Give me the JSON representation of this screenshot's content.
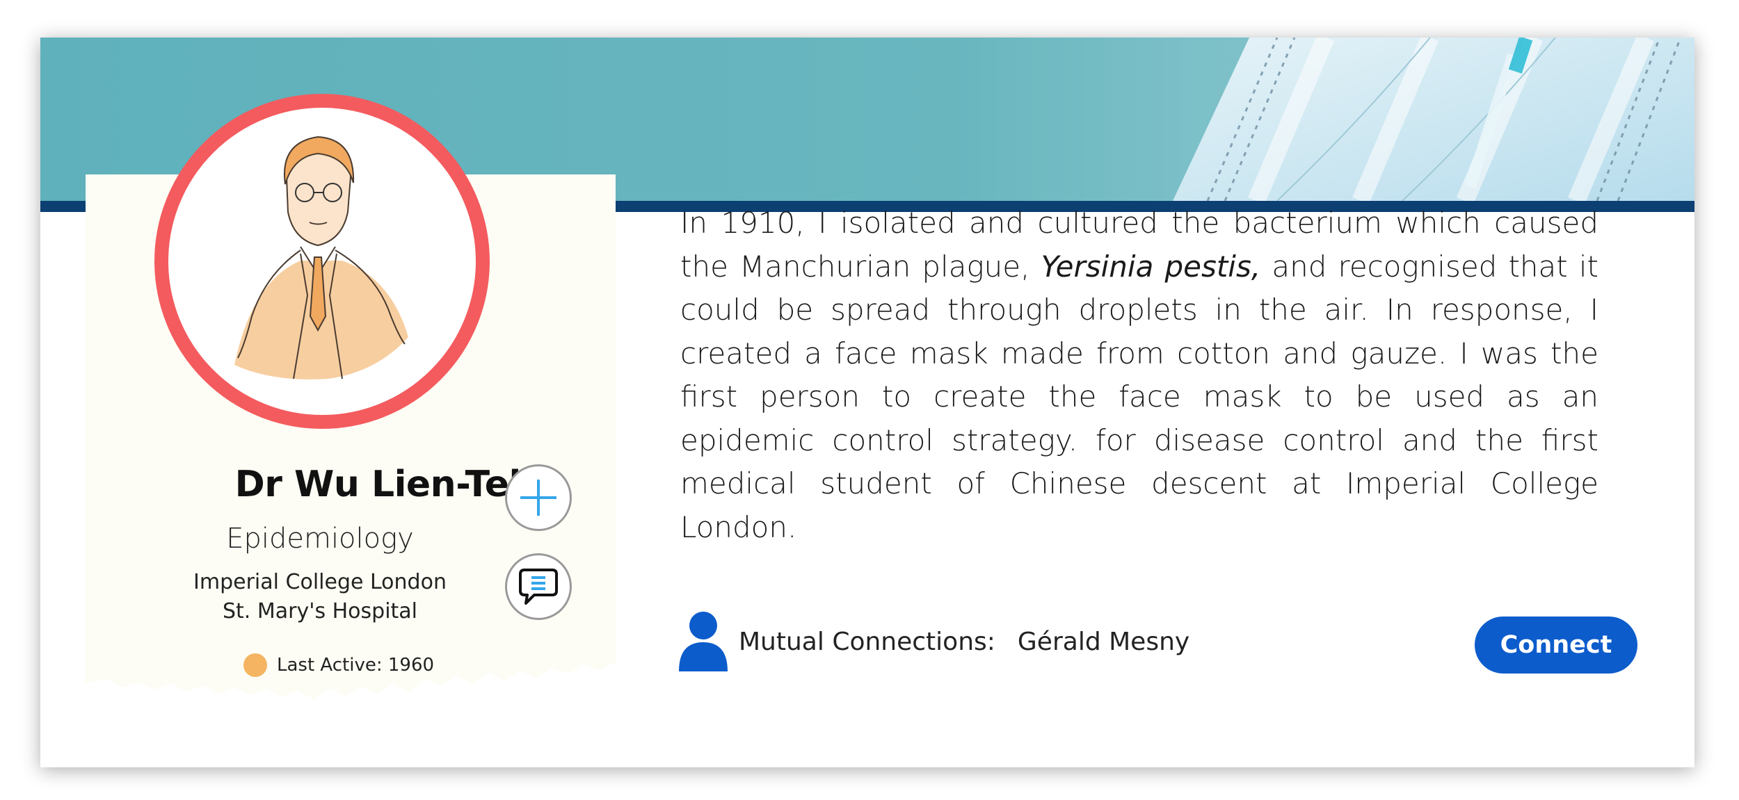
{
  "profile": {
    "name": "Dr Wu Lien-Teh",
    "field": "Epidemiology",
    "institution_1": "Imperial College London",
    "institution_2": "St. Mary's Hospital",
    "last_active": "Last Active: 1960",
    "last_active_color": "#f5b461",
    "avatar_ring_color": "#f45b5e"
  },
  "bio": {
    "part1": "In 1910, I isolated and cultured the bacterium which caused the Manchurian plague, ",
    "part2_italic": "Yersinia pestis,",
    "part3": " and recognised that it could be spread through droplets in the air. In response, I created a face mask made from cotton and gauze. I was the first person to create the face mask to be used as an epidemic control strategy. for disease control and the first medical student of Chinese descent at Imperial College London."
  },
  "mutual": {
    "label": "Mutual Connections:",
    "names": "Gérald Mesny"
  },
  "actions": {
    "connect_label": "Connect",
    "connect_color": "#0c5ccc",
    "add_icon": "plus-icon",
    "message_icon": "chat-bubble-icon"
  },
  "colors": {
    "banner_bar": "#0c3f72",
    "banner_teal": "#5fb1bb"
  }
}
